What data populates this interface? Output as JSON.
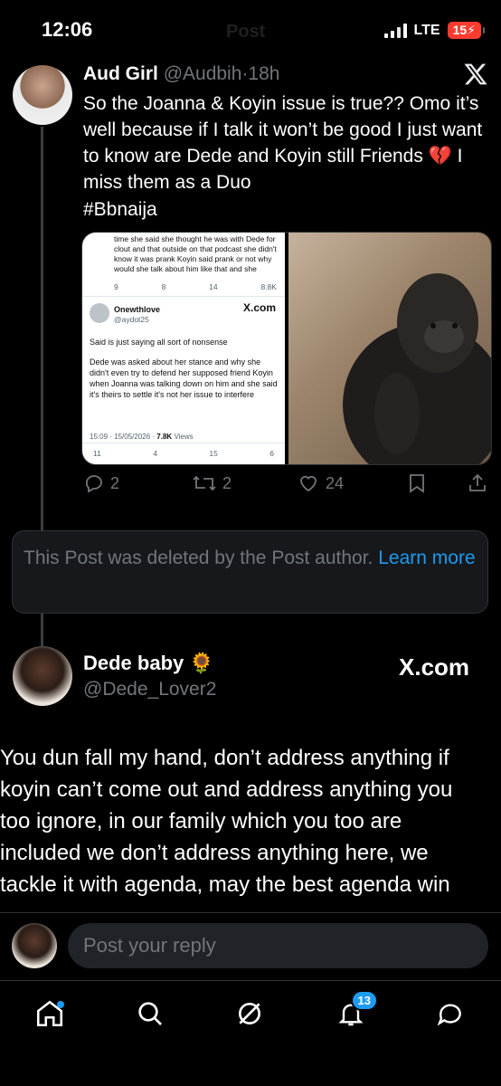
{
  "status_bar": {
    "time": "12:06",
    "network": "LTE",
    "battery": "15"
  },
  "header": {
    "title": "Post"
  },
  "main_tweet": {
    "name": "Aud Girl",
    "handle": "@Audbih",
    "sep": "·",
    "age": "18h",
    "text": "So the Joanna & Koyin issue is true?? Omo it’s well because if I talk it won’t be good I just want to know are Dede and Koyin still Friends 💔 I miss them as a Duo",
    "hashtag": "#Bbnaija",
    "stats": {
      "replies": "2",
      "reposts": "2",
      "likes": "24"
    }
  },
  "embedded_screenshot": {
    "top_text": "time she said she thought he was with Dede for clout and that outside on that podcast she didn't know it was prank Koyin said prank or not why would she talk about him like that and she",
    "top_stats": {
      "replies": "9",
      "reposts": "8",
      "likes": "14",
      "views": "8.8K"
    },
    "user_name": "Onewthlove",
    "user_handle": "@aydot25",
    "brand": "X.com",
    "line1": "Said is just saying all sort of nonsense",
    "line2": "Dede was asked about her stance and why she didn't even try to defend her supposed friend Koyin when Joanna was talking down on him and she said it's theirs to settle it's not her issue to interfere",
    "meta_time": "15:09 · 15/05/2026 ·",
    "meta_views": "7.8K",
    "meta_views_label": "Views",
    "bottom_stats": {
      "replies": "11",
      "reposts": "4",
      "likes": "15",
      "bookmarks": "6"
    }
  },
  "deleted_notice": {
    "text": "This Post was deleted by the Post author.",
    "link": "Learn more"
  },
  "reply_tweet": {
    "name": "Dede baby",
    "emoji": "🌻",
    "handle": "@Dede_Lover2",
    "brand": "X.com",
    "text": "You dun fall my hand, don’t address anything if koyin can’t come out and address anything you too ignore, in our family which you too are included we don’t address anything here, we tackle it with agenda, may the best agenda win"
  },
  "reply_bar": {
    "placeholder": "Post your reply"
  },
  "bottom_nav": {
    "notifications_badge": "13"
  },
  "colors": {
    "accent": "#1d9bf0",
    "background": "#000000",
    "muted": "#71767b",
    "battery": "#ff3b30"
  }
}
